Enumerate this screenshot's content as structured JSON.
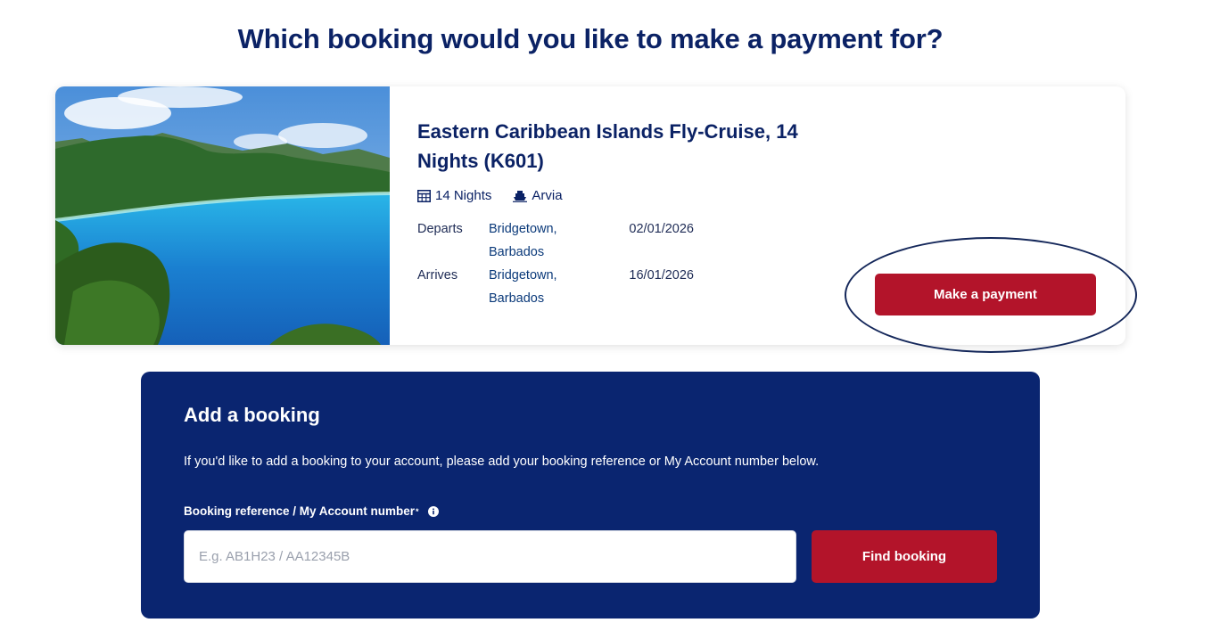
{
  "page": {
    "title": "Which booking would you like to make a payment for?"
  },
  "booking": {
    "cruise_title": "Eastern Caribbean Islands Fly-Cruise, 14 Nights (K601)",
    "nights": "14 Nights",
    "ship": "Arvia",
    "departs": {
      "label": "Departs",
      "place_line1": "Bridgetown,",
      "place_line2": "Barbados",
      "date": "02/01/2026"
    },
    "arrives": {
      "label": "Arrives",
      "place_line1": "Bridgetown,",
      "place_line2": "Barbados",
      "date": "16/01/2026"
    },
    "pay_button_label": "Make a payment"
  },
  "add_booking": {
    "title": "Add a booking",
    "description": "If you'd like to add a booking to your account, please add your booking reference or My Account number below.",
    "field_label": "Booking reference / My Account number",
    "required_mark": "*",
    "input_placeholder": "E.g. AB1H23 / AA12345B",
    "input_value": "",
    "find_button_label": "Find booking"
  },
  "icons": {
    "calendar": "calendar-icon",
    "ship": "ship-icon",
    "info": "info-icon"
  },
  "colors": {
    "navy": "#0b2265",
    "panel": "#0a2570",
    "button_red": "#b3142a"
  }
}
